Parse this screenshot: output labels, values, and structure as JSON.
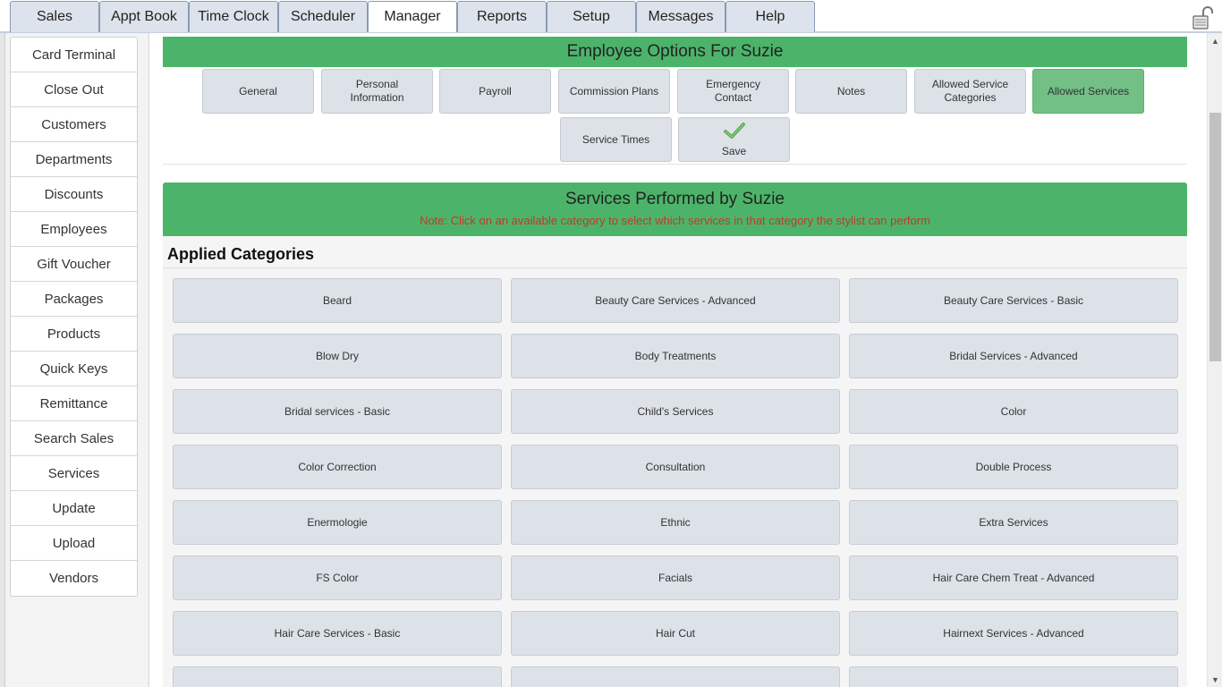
{
  "top_tabs": [
    {
      "label": "Sales"
    },
    {
      "label": "Appt Book"
    },
    {
      "label": "Time Clock"
    },
    {
      "label": "Scheduler"
    },
    {
      "label": "Manager",
      "active": true
    },
    {
      "label": "Reports"
    },
    {
      "label": "Setup"
    },
    {
      "label": "Messages"
    },
    {
      "label": "Help"
    }
  ],
  "sidebar": {
    "items": [
      {
        "label": "Card Terminal"
      },
      {
        "label": "Close Out"
      },
      {
        "label": "Customers"
      },
      {
        "label": "Departments"
      },
      {
        "label": "Discounts"
      },
      {
        "label": "Employees"
      },
      {
        "label": "Gift Voucher"
      },
      {
        "label": "Packages"
      },
      {
        "label": "Products"
      },
      {
        "label": "Quick Keys"
      },
      {
        "label": "Remittance"
      },
      {
        "label": "Search Sales"
      },
      {
        "label": "Services"
      },
      {
        "label": "Update"
      },
      {
        "label": "Upload"
      },
      {
        "label": "Vendors"
      }
    ]
  },
  "employee_options": {
    "title": "Employee Options For Suzie",
    "buttons": [
      {
        "label": "General"
      },
      {
        "label": "Personal Information"
      },
      {
        "label": "Payroll"
      },
      {
        "label": "Commission Plans"
      },
      {
        "label": "Emergency Contact"
      },
      {
        "label": "Notes"
      },
      {
        "label": "Allowed Service Categories"
      },
      {
        "label": "Allowed Services",
        "selected": true
      },
      {
        "label": "Service Times"
      }
    ],
    "save_label": "Save"
  },
  "services": {
    "title": "Services Performed by Suzie",
    "note": "Note: Click on an available category to select which services in that category the stylist can perform",
    "applied_title": "Applied Categories",
    "categories": [
      "Beard",
      "Beauty Care Services - Advanced",
      "Beauty Care Services - Basic",
      "Blow Dry",
      "Body Treatments",
      "Bridal Services - Advanced",
      "Bridal services - Basic",
      "Child's Services",
      "Color",
      "Color Correction",
      "Consultation",
      "Double Process",
      "Enermologie",
      "Ethnic",
      "Extra Services",
      "FS Color",
      "Facials",
      "Hair Care Chem Treat - Advanced",
      "Hair Care Services - Basic",
      "Hair Cut",
      "Hairnext Services - Advanced"
    ]
  },
  "colors": {
    "header_green": "#4cb46a",
    "selected_green": "#72c086",
    "note_red": "#c0392b",
    "button_grey": "#dde1e8"
  }
}
